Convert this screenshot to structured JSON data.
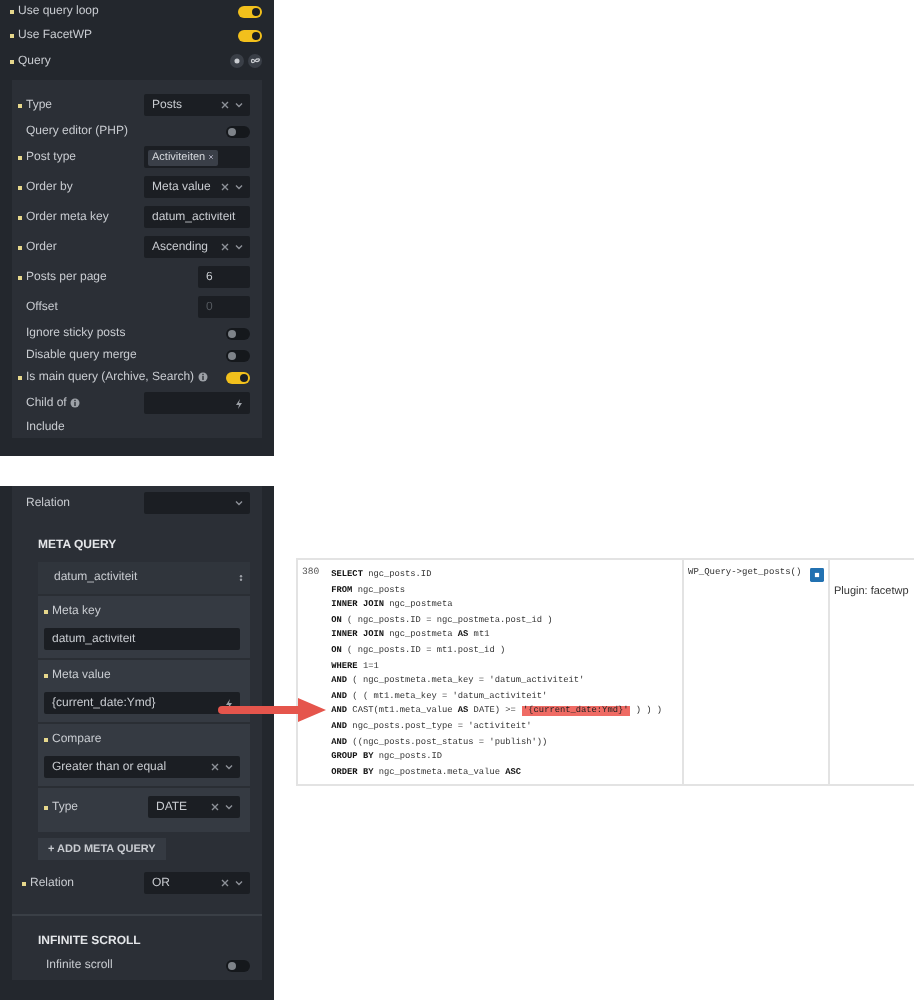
{
  "settings": [
    {
      "label": "Use query loop",
      "dot": true,
      "on": true
    },
    {
      "label": "Use FacetWP",
      "dot": true,
      "on": true
    }
  ],
  "query": {
    "label": "Query",
    "dot": true,
    "controls": [
      {
        "kind": "select",
        "label": "Type",
        "dot": true,
        "value": "Posts"
      },
      {
        "kind": "toggle",
        "label": "Query editor (PHP)",
        "dot": false,
        "on": false
      },
      {
        "kind": "tags",
        "label": "Post type",
        "dot": true,
        "tags": [
          "Activiteiten"
        ]
      },
      {
        "kind": "select",
        "label": "Order by",
        "dot": true,
        "value": "Meta value"
      },
      {
        "kind": "input",
        "label": "Order meta key",
        "dot": true,
        "value": "datum_activiteit"
      },
      {
        "kind": "select",
        "label": "Order",
        "dot": true,
        "value": "Ascending"
      },
      {
        "kind": "number",
        "label": "Posts per page",
        "dot": true,
        "value": "6"
      },
      {
        "kind": "number",
        "label": "Offset",
        "dot": false,
        "placeholder": "0"
      },
      {
        "kind": "toggle",
        "label": "Ignore sticky posts",
        "dot": false,
        "on": false
      },
      {
        "kind": "toggle",
        "label": "Disable query merge",
        "dot": false,
        "on": false
      },
      {
        "kind": "toggle",
        "label": "Is main query (Archive, Search)",
        "dot": true,
        "on": true,
        "info": true
      },
      {
        "kind": "dynamic",
        "label": "Child of",
        "dot": false,
        "info": true
      },
      {
        "kind": "heading",
        "label": "Include",
        "dot": false
      }
    ],
    "tail": [
      {
        "kind": "select",
        "label": "Relation",
        "dot": false
      }
    ]
  },
  "meta_query": {
    "title": "META QUERY",
    "items": [
      {
        "name": "datum_activiteit",
        "fields": [
          {
            "kind": "input",
            "label": "Meta key",
            "dot": true,
            "stacked": true,
            "value": "datum_activiteit"
          },
          {
            "kind": "dynamic",
            "label": "Meta value",
            "dot": true,
            "stacked": true,
            "value": "{current_date:Ymd}"
          },
          {
            "kind": "select",
            "label": "Compare",
            "dot": true,
            "stacked": true,
            "value": "Greater than or equal"
          },
          {
            "kind": "select",
            "label": "Type",
            "dot": true,
            "stacked": false,
            "value": "DATE"
          }
        ]
      }
    ],
    "add_button": "+ ADD META QUERY",
    "relation": {
      "kind": "select",
      "label": "Relation",
      "dot": true,
      "value": "OR"
    }
  },
  "infinite_scroll": {
    "title": "INFINITE SCROLL",
    "controls": [
      {
        "kind": "toggle",
        "label": "Infinite scroll",
        "dot": false,
        "on": false
      }
    ]
  },
  "query_monitor": {
    "line_number": "380",
    "caller": "WP_Query->get_posts()",
    "component": "Plugin: facetwp",
    "lines": [
      {
        "text": "**SELECT** ngc_posts.ID"
      },
      {
        "text": "**FROM** ngc_posts"
      },
      {
        "text": "**INNER JOIN** ngc_postmeta"
      },
      {
        "text": "**ON** ( ngc_posts.ID = ngc_postmeta.post_id )"
      },
      {
        "text": "**INNER JOIN** ngc_postmeta **AS** mt1"
      },
      {
        "text": "**ON** ( ngc_posts.ID = mt1.post_id )"
      },
      {
        "text": "**WHERE** 1=1"
      },
      {
        "text": "**AND** ( ngc_postmeta.meta_key = 'datum_activiteit'"
      },
      {
        "text": "**AND** ( ( mt1.meta_key = 'datum_activiteit'"
      },
      {
        "text": "**AND** CAST(mt1.meta_value **AS** DATE) >= ",
        "highlight": "'{current_date:Ymd}'",
        "after": " ) ) )"
      },
      {
        "text": "**AND** ngc_posts.post_type = 'activiteit'"
      },
      {
        "text": "**AND** ((ngc_posts.post_status = 'publish'))"
      },
      {
        "text": "**GROUP BY** ngc_posts.ID"
      },
      {
        "text": "**ORDER BY** ngc_postmeta.meta_value **ASC**"
      }
    ]
  }
}
